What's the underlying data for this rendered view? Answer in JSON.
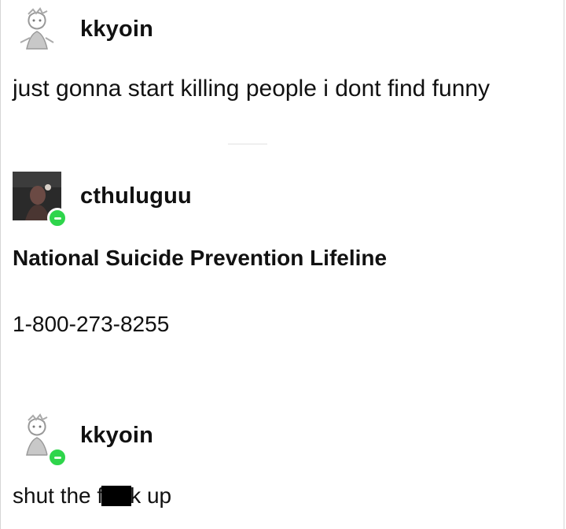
{
  "posts": [
    {
      "username": "kkyoin",
      "text": "just gonna start killing people i dont find funny",
      "avatar_icon": "sketch-character-avatar-icon"
    },
    {
      "username": "cthuluguu",
      "title": "National Suicide Prevention Lifeline",
      "phone": "1-800-273-8255",
      "avatar_icon": "dark-photo-avatar-icon",
      "online_badge": "green-online-badge-icon"
    },
    {
      "username": "kkyoin",
      "text_before": "shut the f",
      "text_after": "k up",
      "avatar_icon": "sketch-character-avatar-icon",
      "online_badge": "green-online-badge-icon"
    }
  ],
  "colors": {
    "online_badge": "#2ed54b",
    "censor": "#000000"
  }
}
